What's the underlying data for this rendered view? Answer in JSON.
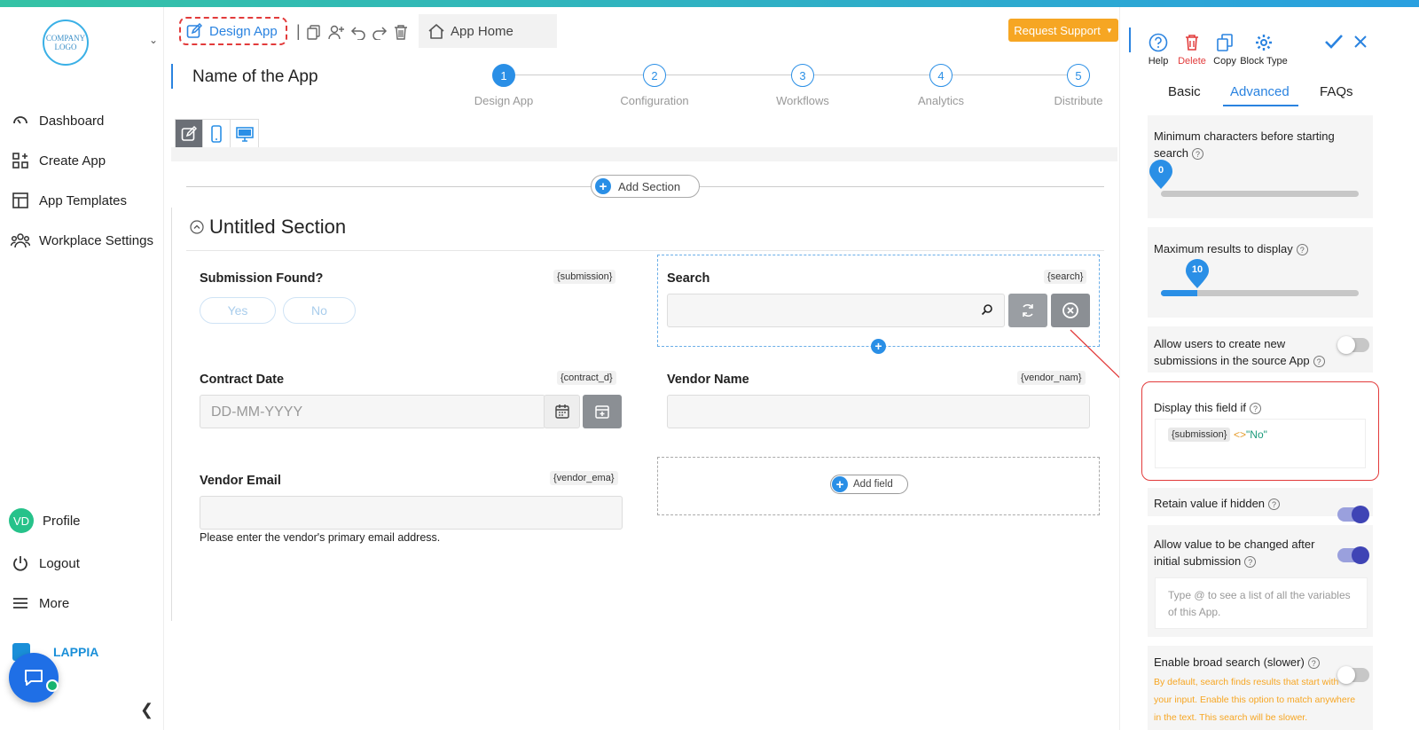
{
  "sidebar": {
    "logo_text": "COMPANY LOGO",
    "items": [
      {
        "label": "Dashboard",
        "icon": "gauge-icon"
      },
      {
        "label": "Create App",
        "icon": "grid-plus-icon"
      },
      {
        "label": "App Templates",
        "icon": "layout-icon"
      },
      {
        "label": "Workplace Settings",
        "icon": "users-icon"
      }
    ],
    "profile_initials": "VD",
    "profile_label": "Profile",
    "logout_label": "Logout",
    "more_label": "More",
    "brand_text": "LAPPIA"
  },
  "header": {
    "design_app_tab": "Design App",
    "app_home_tab": "App Home",
    "request_support": "Request Support",
    "app_name": "Name of the App"
  },
  "steps": [
    {
      "num": "1",
      "label": "Design App"
    },
    {
      "num": "2",
      "label": "Configuration"
    },
    {
      "num": "3",
      "label": "Workflows"
    },
    {
      "num": "4",
      "label": "Analytics"
    },
    {
      "num": "5",
      "label": "Distribute"
    }
  ],
  "canvas": {
    "add_section": "Add Section",
    "section_title": "Untitled Section",
    "add_field": "Add field",
    "fields": {
      "submission": {
        "label": "Submission Found?",
        "tag": "{submission}",
        "yes": "Yes",
        "no": "No"
      },
      "search": {
        "label": "Search",
        "tag": "{search}"
      },
      "contract_date": {
        "label": "Contract Date",
        "tag": "{contract_d}",
        "placeholder": "DD-MM-YYYY"
      },
      "vendor_name": {
        "label": "Vendor Name",
        "tag": "{vendor_nam}"
      },
      "vendor_email": {
        "label": "Vendor Email",
        "tag": "{vendor_ema}",
        "helper": "Please enter the vendor's primary email address."
      }
    }
  },
  "right_panel": {
    "actions": {
      "help": "Help",
      "delete": "Delete",
      "copy": "Copy",
      "block_type": "Block Type"
    },
    "tabs": [
      "Basic",
      "Advanced",
      "FAQs"
    ],
    "active_tab": "Advanced",
    "min_chars_label": "Minimum characters before starting search",
    "min_chars_value": 0,
    "max_results_label": "Maximum results to display",
    "max_results_value": 10,
    "allow_create_label": "Allow users to create new submissions in the source App",
    "allow_create_on": false,
    "display_if_label": "Display this field if",
    "display_if_tag": "{submission}",
    "display_if_op": "<>",
    "display_if_value": "\"No\"",
    "retain_label": "Retain value if hidden",
    "retain_on": true,
    "allow_change_label": "Allow value to be changed after initial submission",
    "allow_change_on": true,
    "variables_placeholder": "Type @ to see a list of all the variables of this App.",
    "broad_search_label": "Enable broad search (slower)",
    "broad_search_on": false,
    "broad_search_note": "By default, search finds results that start with your input. Enable this option to match anywhere in the text. This search will be slower."
  },
  "colors": {
    "accent": "#2a8fe6",
    "warning": "#f6a623",
    "danger": "#e23b3b",
    "toggle_on": "#5b5fc7"
  }
}
